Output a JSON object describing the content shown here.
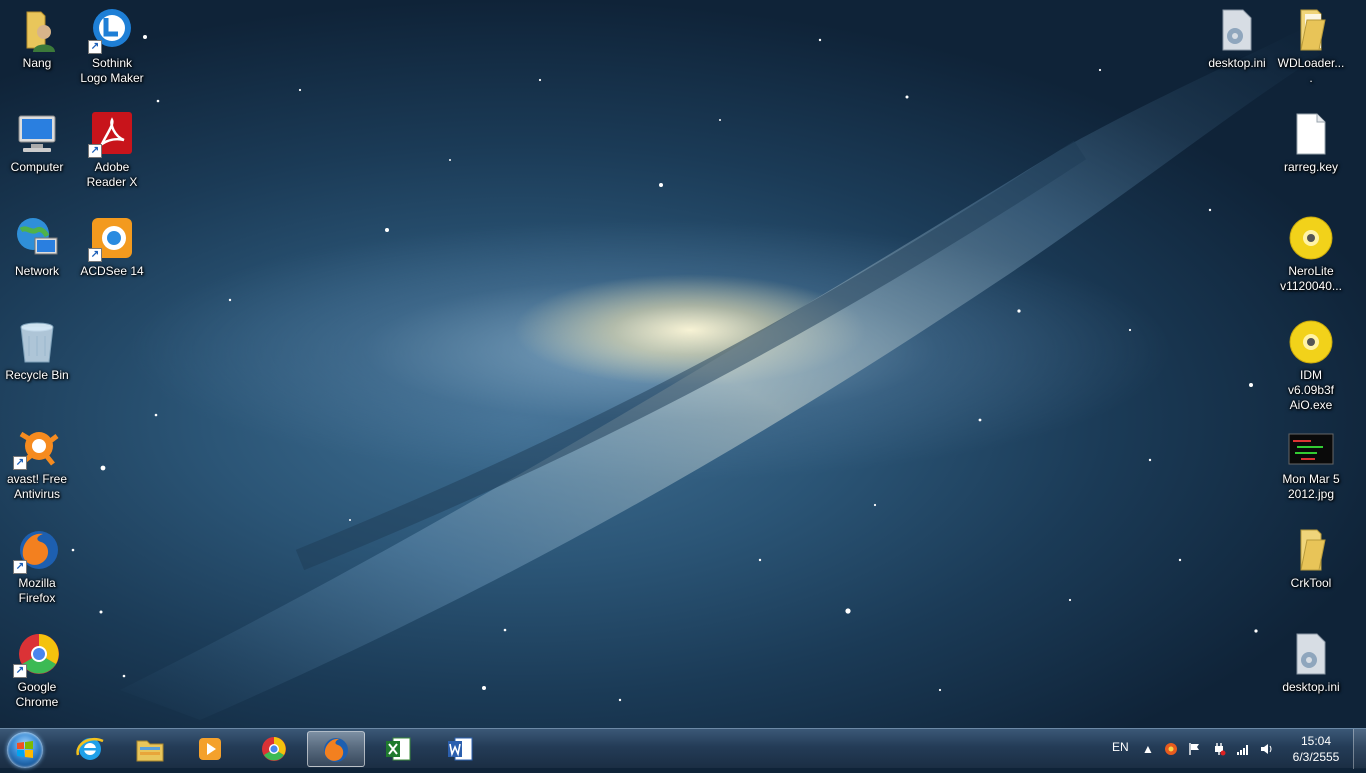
{
  "desktop": {
    "left_icons": [
      {
        "label": "Nang",
        "icon": "user-folder-icon"
      },
      {
        "label": "Sothink Logo Maker",
        "icon": "sothink-logo-maker-icon"
      },
      {
        "label": "Computer",
        "icon": "computer-icon"
      },
      {
        "label": "Adobe Reader X",
        "icon": "adobe-reader-icon"
      },
      {
        "label": "Network",
        "icon": "network-icon"
      },
      {
        "label": "ACDSee 14",
        "icon": "acdsee-icon"
      },
      {
        "label": "Recycle Bin",
        "icon": "recycle-bin-icon"
      },
      {
        "label": "avast! Free Antivirus",
        "icon": "avast-icon"
      },
      {
        "label": "Mozilla Firefox",
        "icon": "firefox-icon"
      },
      {
        "label": "Google Chrome",
        "icon": "chrome-icon"
      }
    ],
    "right_icons": [
      {
        "label": "desktop.ini",
        "icon": "settings-file-icon"
      },
      {
        "label": "WDLoader....",
        "icon": "folder-icon"
      },
      {
        "label": "rarreg.key",
        "icon": "blank-file-icon"
      },
      {
        "label": "NeroLite v1120040...",
        "icon": "disc-image-icon"
      },
      {
        "label": "IDM v6.09b3f AiO.exe",
        "icon": "disc-image-icon"
      },
      {
        "label": "Mon Mar 5 2012.jpg",
        "icon": "image-file-icon"
      },
      {
        "label": "CrkTool",
        "icon": "folder-icon"
      },
      {
        "label": "desktop.ini",
        "icon": "settings-file-icon"
      }
    ]
  },
  "taskbar": {
    "pinned": [
      {
        "name": "internet-explorer",
        "icon": "internet-explorer-icon"
      },
      {
        "name": "file-explorer",
        "icon": "folder-library-icon"
      },
      {
        "name": "media-player",
        "icon": "media-player-icon"
      },
      {
        "name": "chrome",
        "icon": "chrome-icon"
      },
      {
        "name": "firefox",
        "icon": "firefox-icon",
        "active": true
      },
      {
        "name": "excel",
        "icon": "excel-icon"
      },
      {
        "name": "word",
        "icon": "word-icon"
      }
    ],
    "tray": {
      "language": "EN",
      "time": "15:04",
      "date": "6/3/2555"
    }
  }
}
